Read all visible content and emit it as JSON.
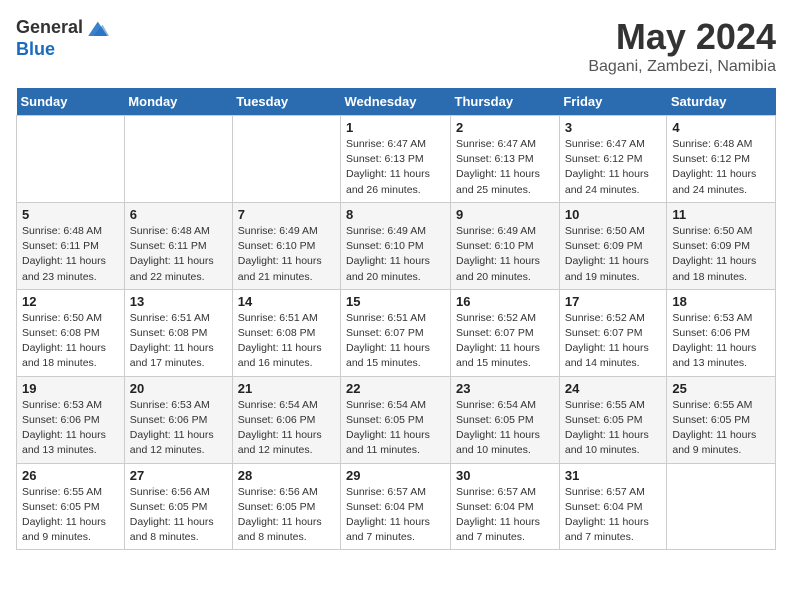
{
  "logo": {
    "general": "General",
    "blue": "Blue"
  },
  "title": "May 2024",
  "location": "Bagani, Zambezi, Namibia",
  "days_of_week": [
    "Sunday",
    "Monday",
    "Tuesday",
    "Wednesday",
    "Thursday",
    "Friday",
    "Saturday"
  ],
  "weeks": [
    [
      {
        "day": "",
        "info": ""
      },
      {
        "day": "",
        "info": ""
      },
      {
        "day": "",
        "info": ""
      },
      {
        "day": "1",
        "info": "Sunrise: 6:47 AM\nSunset: 6:13 PM\nDaylight: 11 hours and 26 minutes."
      },
      {
        "day": "2",
        "info": "Sunrise: 6:47 AM\nSunset: 6:13 PM\nDaylight: 11 hours and 25 minutes."
      },
      {
        "day": "3",
        "info": "Sunrise: 6:47 AM\nSunset: 6:12 PM\nDaylight: 11 hours and 24 minutes."
      },
      {
        "day": "4",
        "info": "Sunrise: 6:48 AM\nSunset: 6:12 PM\nDaylight: 11 hours and 24 minutes."
      }
    ],
    [
      {
        "day": "5",
        "info": "Sunrise: 6:48 AM\nSunset: 6:11 PM\nDaylight: 11 hours and 23 minutes."
      },
      {
        "day": "6",
        "info": "Sunrise: 6:48 AM\nSunset: 6:11 PM\nDaylight: 11 hours and 22 minutes."
      },
      {
        "day": "7",
        "info": "Sunrise: 6:49 AM\nSunset: 6:10 PM\nDaylight: 11 hours and 21 minutes."
      },
      {
        "day": "8",
        "info": "Sunrise: 6:49 AM\nSunset: 6:10 PM\nDaylight: 11 hours and 20 minutes."
      },
      {
        "day": "9",
        "info": "Sunrise: 6:49 AM\nSunset: 6:10 PM\nDaylight: 11 hours and 20 minutes."
      },
      {
        "day": "10",
        "info": "Sunrise: 6:50 AM\nSunset: 6:09 PM\nDaylight: 11 hours and 19 minutes."
      },
      {
        "day": "11",
        "info": "Sunrise: 6:50 AM\nSunset: 6:09 PM\nDaylight: 11 hours and 18 minutes."
      }
    ],
    [
      {
        "day": "12",
        "info": "Sunrise: 6:50 AM\nSunset: 6:08 PM\nDaylight: 11 hours and 18 minutes."
      },
      {
        "day": "13",
        "info": "Sunrise: 6:51 AM\nSunset: 6:08 PM\nDaylight: 11 hours and 17 minutes."
      },
      {
        "day": "14",
        "info": "Sunrise: 6:51 AM\nSunset: 6:08 PM\nDaylight: 11 hours and 16 minutes."
      },
      {
        "day": "15",
        "info": "Sunrise: 6:51 AM\nSunset: 6:07 PM\nDaylight: 11 hours and 15 minutes."
      },
      {
        "day": "16",
        "info": "Sunrise: 6:52 AM\nSunset: 6:07 PM\nDaylight: 11 hours and 15 minutes."
      },
      {
        "day": "17",
        "info": "Sunrise: 6:52 AM\nSunset: 6:07 PM\nDaylight: 11 hours and 14 minutes."
      },
      {
        "day": "18",
        "info": "Sunrise: 6:53 AM\nSunset: 6:06 PM\nDaylight: 11 hours and 13 minutes."
      }
    ],
    [
      {
        "day": "19",
        "info": "Sunrise: 6:53 AM\nSunset: 6:06 PM\nDaylight: 11 hours and 13 minutes."
      },
      {
        "day": "20",
        "info": "Sunrise: 6:53 AM\nSunset: 6:06 PM\nDaylight: 11 hours and 12 minutes."
      },
      {
        "day": "21",
        "info": "Sunrise: 6:54 AM\nSunset: 6:06 PM\nDaylight: 11 hours and 12 minutes."
      },
      {
        "day": "22",
        "info": "Sunrise: 6:54 AM\nSunset: 6:05 PM\nDaylight: 11 hours and 11 minutes."
      },
      {
        "day": "23",
        "info": "Sunrise: 6:54 AM\nSunset: 6:05 PM\nDaylight: 11 hours and 10 minutes."
      },
      {
        "day": "24",
        "info": "Sunrise: 6:55 AM\nSunset: 6:05 PM\nDaylight: 11 hours and 10 minutes."
      },
      {
        "day": "25",
        "info": "Sunrise: 6:55 AM\nSunset: 6:05 PM\nDaylight: 11 hours and 9 minutes."
      }
    ],
    [
      {
        "day": "26",
        "info": "Sunrise: 6:55 AM\nSunset: 6:05 PM\nDaylight: 11 hours and 9 minutes."
      },
      {
        "day": "27",
        "info": "Sunrise: 6:56 AM\nSunset: 6:05 PM\nDaylight: 11 hours and 8 minutes."
      },
      {
        "day": "28",
        "info": "Sunrise: 6:56 AM\nSunset: 6:05 PM\nDaylight: 11 hours and 8 minutes."
      },
      {
        "day": "29",
        "info": "Sunrise: 6:57 AM\nSunset: 6:04 PM\nDaylight: 11 hours and 7 minutes."
      },
      {
        "day": "30",
        "info": "Sunrise: 6:57 AM\nSunset: 6:04 PM\nDaylight: 11 hours and 7 minutes."
      },
      {
        "day": "31",
        "info": "Sunrise: 6:57 AM\nSunset: 6:04 PM\nDaylight: 11 hours and 7 minutes."
      },
      {
        "day": "",
        "info": ""
      }
    ]
  ]
}
